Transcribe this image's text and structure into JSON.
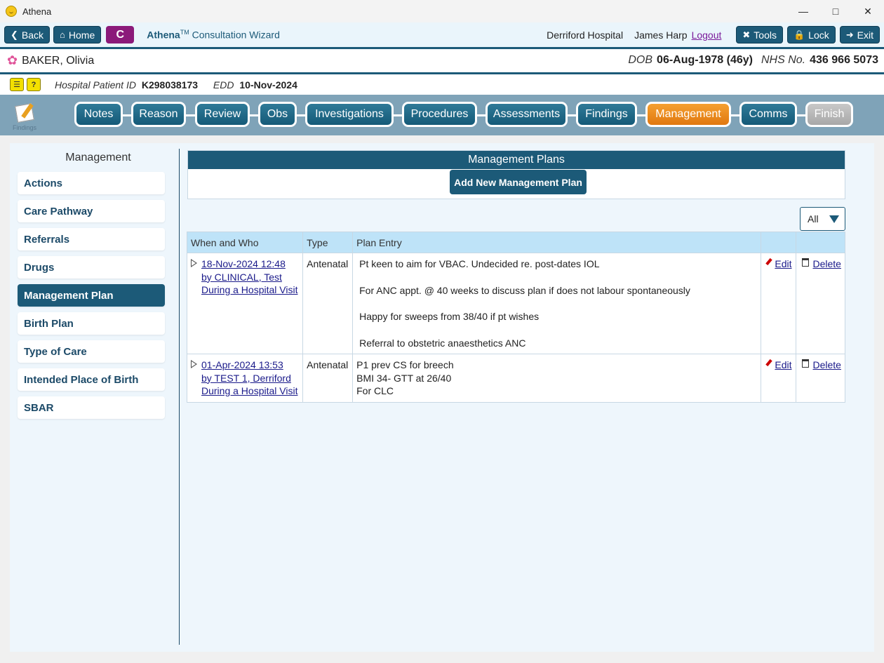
{
  "window": {
    "title": "Athena",
    "icon": "athena-logo-icon"
  },
  "topnav": {
    "back": "Back",
    "home": "Home",
    "c_button": "C",
    "wizard_brand": "Athena",
    "wizard_tm": "TM",
    "wizard_title": " Consultation Wizard",
    "hospital": "Derriford Hospital",
    "user": "James Harp",
    "logout": "Logout",
    "tools": "Tools",
    "lock": "Lock",
    "exit": "Exit"
  },
  "patient": {
    "name": "BAKER, Olivia",
    "dob_label": "DOB",
    "dob": "06-Aug-1978 (46y)",
    "nhs_label": "NHS No.",
    "nhs": "436 966 5073",
    "hospital_id_label": "Hospital Patient ID",
    "hospital_id": "K298038173",
    "edd_label": "EDD",
    "edd": "10-Nov-2024"
  },
  "steps": {
    "findings_label": "Findings",
    "items": [
      "Notes",
      "Reason",
      "Review",
      "Obs",
      "Investigations",
      "Procedures",
      "Assessments",
      "Findings",
      "Management",
      "Comms",
      "Finish"
    ],
    "active": "Management"
  },
  "sidebar": {
    "title": "Management",
    "items": [
      "Actions",
      "Care Pathway",
      "Referrals",
      "Drugs",
      "Management Plan",
      "Birth Plan",
      "Type of Care",
      "Intended Place of Birth",
      "SBAR"
    ],
    "active": "Management Plan"
  },
  "plans": {
    "heading": "Management Plans",
    "add_button": "Add New Management Plan",
    "filter_value": "All",
    "columns": [
      "When and Who",
      "Type",
      "Plan Entry",
      "",
      ""
    ],
    "rows": [
      {
        "when": "18-Nov-2024 12:48",
        "who": "by CLINICAL, Test",
        "context": "During a Hospital Visit",
        "type": "Antenatal",
        "entry": [
          "Pt keen to aim for VBAC. Undecided re. post-dates IOL",
          "For ANC appt. @ 40 weeks to discuss plan if does not labour spontaneously",
          "Happy for sweeps from 38/40 if pt wishes",
          "Referral to obstetric anaesthetics ANC"
        ],
        "edit": "Edit",
        "delete": "Delete"
      },
      {
        "when": "01-Apr-2024 13:53",
        "who": "by TEST 1, Derriford",
        "context": "During a Hospital Visit",
        "type": "Antenatal",
        "entry": [
          "P1 prev CS for breech",
          "BMI 34- GTT at 26/40",
          "For CLC"
        ],
        "edit": "Edit",
        "delete": "Delete"
      }
    ]
  },
  "colors": {
    "primary": "#1c5a78",
    "active_step": "#f08a1c",
    "disabled_step": "#b8b8b8",
    "table_header": "#bee3f8",
    "c_button": "#8b1a7a"
  }
}
